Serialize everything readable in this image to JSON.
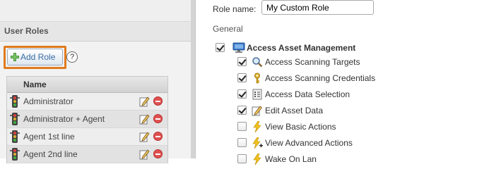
{
  "left_panel": {
    "section_title": "User Roles",
    "add_role_label": "Add Role",
    "help_label": "?",
    "table": {
      "header": "Name",
      "rows": [
        {
          "name": "Administrator"
        },
        {
          "name": "Administrator + Agent"
        },
        {
          "name": "Agent 1st line"
        },
        {
          "name": "Agent 2nd line"
        }
      ]
    }
  },
  "right_panel": {
    "role_name_label": "Role name:",
    "role_name_value": "My Custom Role",
    "section_label": "General",
    "permissions": [
      {
        "label": "Access Asset Management",
        "checked": true,
        "icon": "monitor-icon",
        "level": 0
      },
      {
        "label": "Access Scanning Targets",
        "checked": true,
        "icon": "magnifier-icon",
        "level": 1
      },
      {
        "label": "Access Scanning Credentials",
        "checked": true,
        "icon": "key-icon",
        "level": 1
      },
      {
        "label": "Access Data Selection",
        "checked": true,
        "icon": "data-selection-icon",
        "level": 1
      },
      {
        "label": "Edit Asset Data",
        "checked": true,
        "icon": "edit-icon",
        "level": 1
      },
      {
        "label": "View Basic Actions",
        "checked": false,
        "icon": "lightning-icon",
        "level": 1
      },
      {
        "label": "View Advanced Actions",
        "checked": false,
        "icon": "lightning-plus-icon",
        "level": 1
      },
      {
        "label": "Wake On Lan",
        "checked": false,
        "icon": "lightning-icon",
        "level": 1
      }
    ]
  },
  "colors": {
    "highlight": "#e07b1f",
    "link_blue": "#3a6ea5",
    "delete_red": "#e05050"
  }
}
